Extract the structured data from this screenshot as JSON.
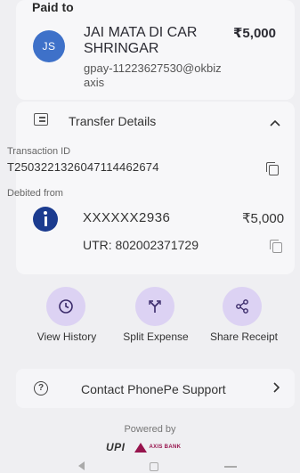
{
  "paid_to": {
    "label": "Paid to",
    "avatar_initials": "JS",
    "payee_name": "JAI MATA DI CAR SHRINGAR",
    "amount": "₹5,000",
    "upi_id": "gpay-11223627530@okbizaxis"
  },
  "transfer_details": {
    "title": "Transfer Details",
    "transaction_id_label": "Transaction ID",
    "transaction_id": "T2503221326047114462674",
    "debited_from_label": "Debited from",
    "account_number": "XXXXXX2936",
    "debited_amount": "₹5,000",
    "utr": "UTR: 802002371729"
  },
  "actions": {
    "view_history": "View History",
    "split_expense": "Split Expense",
    "share_receipt": "Share Receipt"
  },
  "support": {
    "label": "Contact PhonePe Support"
  },
  "footer": {
    "powered_by": "Powered by",
    "upi_logo": "UPI",
    "bank_name": "AXIS BANK"
  },
  "colors": {
    "avatar": "#3e71c9",
    "action_circle": "#dcd2f3",
    "accent": "#5f259f",
    "axis_bank": "#97144d"
  },
  "icons": {
    "transfer_details": "list-icon",
    "collapse": "chevron-up-icon",
    "copy": "copy-icon",
    "history": "clock-icon",
    "split": "split-icon",
    "share": "share-icon",
    "support": "help-icon",
    "support_chevron": "chevron-right-icon"
  }
}
